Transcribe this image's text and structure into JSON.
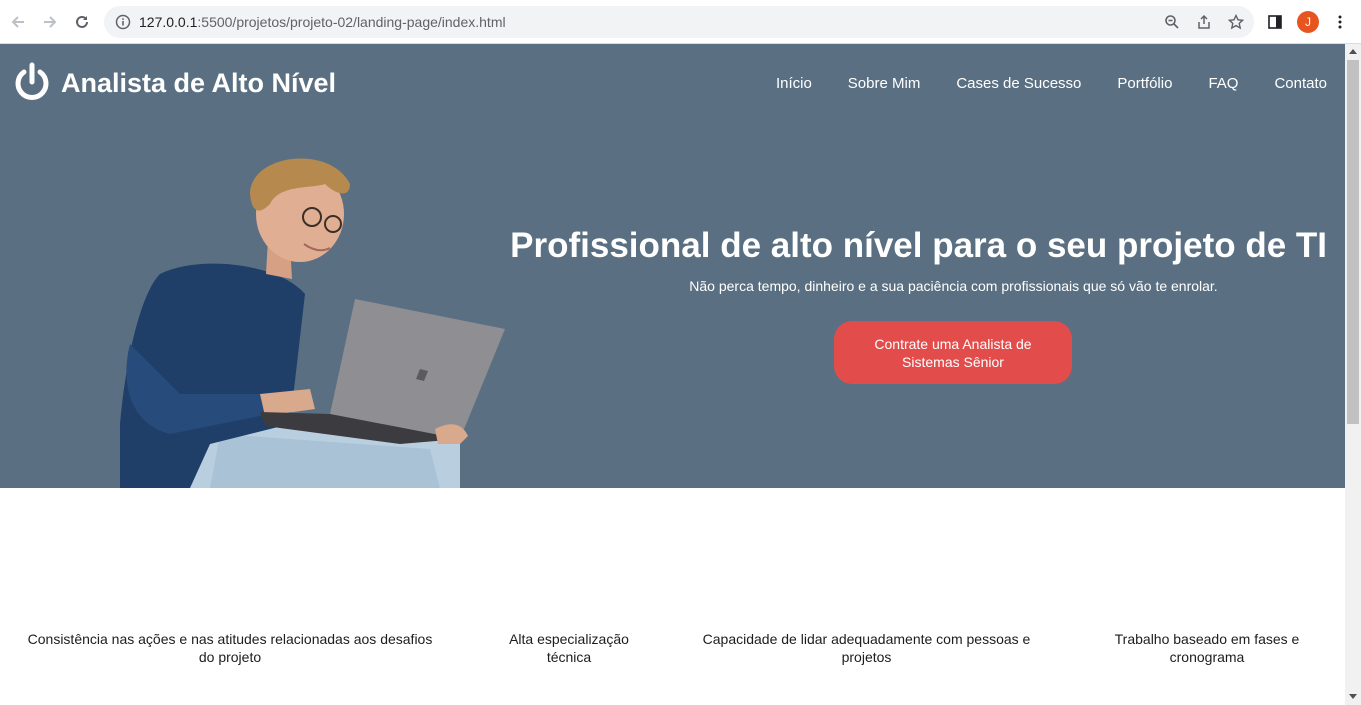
{
  "browser": {
    "url_host": "127.0.0.1",
    "url_path": ":5500/projetos/projeto-02/landing-page/index.html",
    "profile_initial": "J"
  },
  "header": {
    "brand": "Analista de Alto Nível",
    "menu": [
      "Início",
      "Sobre Mim",
      "Cases de Sucesso",
      "Portfólio",
      "FAQ",
      "Contato"
    ]
  },
  "hero": {
    "title": "Profissional de alto nível para o seu projeto de TI",
    "subtitle": "Não perca tempo, dinheiro e a sua paciência com profissionais que só vão te enrolar.",
    "cta_label": "Contrate uma Analista de Sistemas Sênior"
  },
  "features": [
    "Consistência nas ações e nas atitudes relacionadas aos desafios do projeto",
    "Alta especialização técnica",
    "Capacidade de lidar adequadamente com pessoas e projetos",
    "Trabalho baseado em fases e cronograma"
  ],
  "colors": {
    "hero_bg": "#5a7082",
    "cta_bg": "#e24c4b",
    "profile": "#e8541f"
  }
}
